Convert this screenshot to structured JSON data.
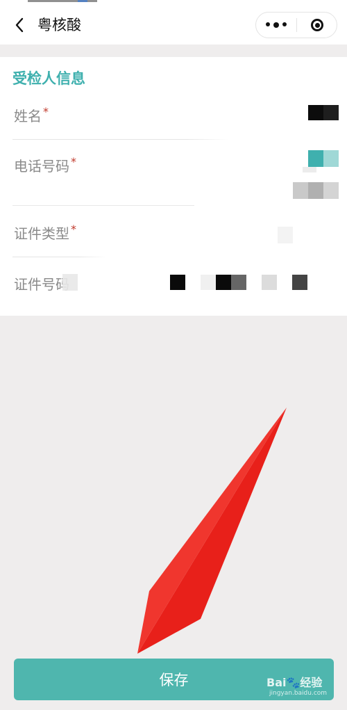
{
  "navbar": {
    "title": "粤核酸"
  },
  "form": {
    "section_title": "受检人信息",
    "fields": [
      {
        "label": "姓名",
        "required": "*"
      },
      {
        "label": "电话号码",
        "required": "*"
      },
      {
        "label": "证件类型",
        "required": "*"
      },
      {
        "label": "证件号码",
        "required": ""
      }
    ]
  },
  "save_button": {
    "label": "保存"
  },
  "watermark": {
    "brand": "Bai🐾经验",
    "url": "jingyan.baidu.com"
  },
  "colors": {
    "accent": "#3fb0ae",
    "button": "#4fb6ae",
    "required": "#c0392b",
    "arrow": "#e8201a"
  }
}
